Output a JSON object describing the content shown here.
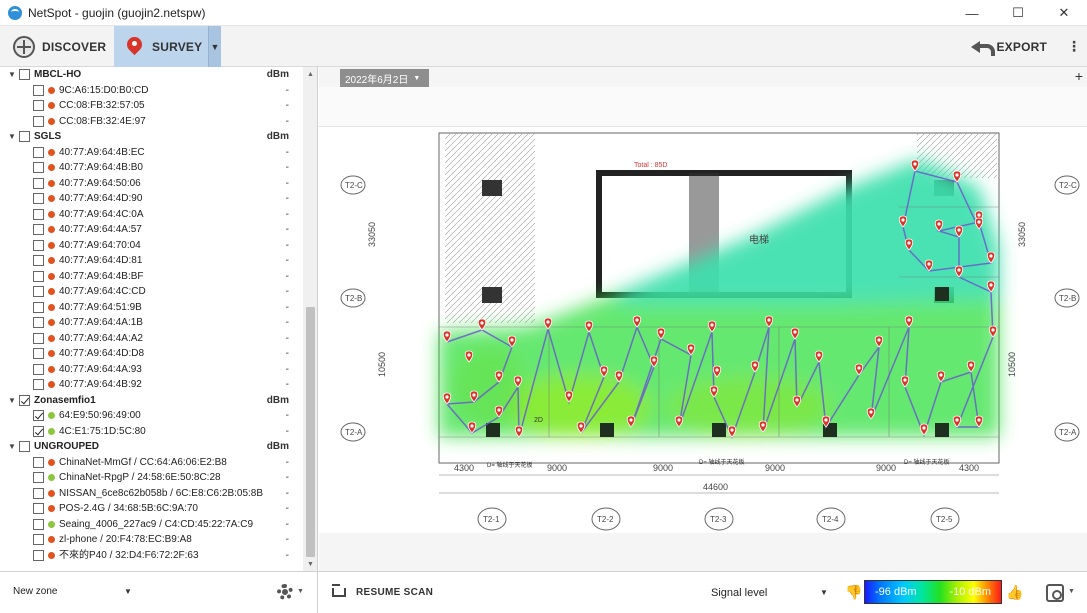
{
  "window": {
    "title": "NetSpot - guojin (guojin2.netspw)",
    "minimize": "—",
    "maximize": "☐",
    "close": "✕"
  },
  "toolbar": {
    "discover_label": "DISCOVER",
    "survey_label": "SURVEY",
    "survey_dropdown": "▼",
    "export_label": "EXPORT",
    "more": "⋮"
  },
  "sidebar": {
    "unit_header": "dBm",
    "groups": [
      {
        "name": "MBCL-HO",
        "checked": false,
        "items": [
          {
            "label": "9C:A6:15:D0:B0:CD",
            "value": "-",
            "color": "red",
            "checked": false
          },
          {
            "label": "CC:08:FB:32:57:05",
            "value": "-",
            "color": "red",
            "checked": false
          },
          {
            "label": "CC:08:FB:32:4E:97",
            "value": "-",
            "color": "red",
            "checked": false
          }
        ]
      },
      {
        "name": "SGLS",
        "checked": false,
        "items": [
          {
            "label": "40:77:A9:64:4B:EC",
            "value": "-",
            "color": "red",
            "checked": false
          },
          {
            "label": "40:77:A9:64:4B:B0",
            "value": "-",
            "color": "red",
            "checked": false
          },
          {
            "label": "40:77:A9:64:50:06",
            "value": "-",
            "color": "red",
            "checked": false
          },
          {
            "label": "40:77:A9:64:4D:90",
            "value": "-",
            "color": "red",
            "checked": false
          },
          {
            "label": "40:77:A9:64:4C:0A",
            "value": "-",
            "color": "red",
            "checked": false
          },
          {
            "label": "40:77:A9:64:4A:57",
            "value": "-",
            "color": "red",
            "checked": false
          },
          {
            "label": "40:77:A9:64:70:04",
            "value": "-",
            "color": "red",
            "checked": false
          },
          {
            "label": "40:77:A9:64:4D:81",
            "value": "-",
            "color": "red",
            "checked": false
          },
          {
            "label": "40:77:A9:64:4B:BF",
            "value": "-",
            "color": "red",
            "checked": false
          },
          {
            "label": "40:77:A9:64:4C:CD",
            "value": "-",
            "color": "red",
            "checked": false
          },
          {
            "label": "40:77:A9:64:51:9B",
            "value": "-",
            "color": "red",
            "checked": false
          },
          {
            "label": "40:77:A9:64:4A:1B",
            "value": "-",
            "color": "red",
            "checked": false
          },
          {
            "label": "40:77:A9:64:4A:A2",
            "value": "-",
            "color": "red",
            "checked": false
          },
          {
            "label": "40:77:A9:64:4D:D8",
            "value": "-",
            "color": "red",
            "checked": false
          },
          {
            "label": "40:77:A9:64:4A:93",
            "value": "-",
            "color": "red",
            "checked": false
          },
          {
            "label": "40:77:A9:64:4B:92",
            "value": "-",
            "color": "red",
            "checked": false
          }
        ]
      },
      {
        "name": "Zonasemfio1",
        "checked": true,
        "items": [
          {
            "label": "64:E9:50:96:49:00",
            "value": "-",
            "color": "green",
            "checked": true
          },
          {
            "label": "4C:E1:75:1D:5C:80",
            "value": "-",
            "color": "green",
            "checked": true
          }
        ]
      },
      {
        "name": "UNGROUPED",
        "checked": false,
        "items": [
          {
            "label": "ChinaNet-MmGf / CC:64:A6:06:E2:B8",
            "value": "-",
            "color": "red",
            "checked": false
          },
          {
            "label": "ChinaNet-RpgP / 24:58:6E:50:8C:28",
            "value": "-",
            "color": "green",
            "checked": false
          },
          {
            "label": "NISSAN_6ce8c62b058b / 6C:E8:C6:2B:05:8B",
            "value": "-",
            "color": "red",
            "checked": false
          },
          {
            "label": "POS-2.4G / 34:68:5B:6C:9A:70",
            "value": "-",
            "color": "red",
            "checked": false
          },
          {
            "label": "Seaing_4006_227ac9 / C4:CD:45:22:7A:C9",
            "value": "-",
            "color": "green",
            "checked": false
          },
          {
            "label": "zl-phone / 20:F4:78:EC:B9:A8",
            "value": "-",
            "color": "red",
            "checked": false
          },
          {
            "label": "不來的P40 / 32:D4:F6:72:2F:63",
            "value": "-",
            "color": "red",
            "checked": false
          }
        ]
      }
    ]
  },
  "map": {
    "date_tab": "2022年6月2日",
    "date_arrow": "▼",
    "add_tab": "+",
    "floorplan_total": "Total : 85D",
    "dimensions": {
      "left_top": "33050",
      "left_bottom": "10500",
      "right_top": "33050",
      "right_bottom": "10500",
      "bottom_segments": [
        "4300",
        "9000",
        "9000",
        "9000",
        "9000",
        "4300"
      ],
      "bottom_total": "44600"
    },
    "grid_labels": [
      "T2-1",
      "T2-2",
      "T2-3",
      "T2-4",
      "T2-5"
    ],
    "side_labels_left": [
      "T2-C",
      "T2-B",
      "T2-A"
    ],
    "side_labels_right": [
      "T2-C",
      "T2-B",
      "T2-A"
    ],
    "room_labels": [
      "电梯",
      "2D",
      "D= 轴线于天花板",
      "D= 轴线于天花板",
      "D= 轴线于天花板"
    ]
  },
  "bottom": {
    "zone_label": "New zone",
    "zone_arrow": "▼",
    "gear_arrow": "▼",
    "resume_label": "RESUME SCAN",
    "visualization": "Signal level",
    "visualization_arrow": "▼",
    "legend_min": "-96 dBm",
    "legend_max": "-10 dBm",
    "thumb_down": "👎",
    "thumb_up": "👍",
    "settings_arrow": "▼"
  },
  "colors": {
    "survey_active": "#bcd4ec",
    "pin": "#d7342a",
    "heat_green": "#33e040",
    "heat_cyan": "#40e0d0",
    "path": "#6a5acd"
  }
}
